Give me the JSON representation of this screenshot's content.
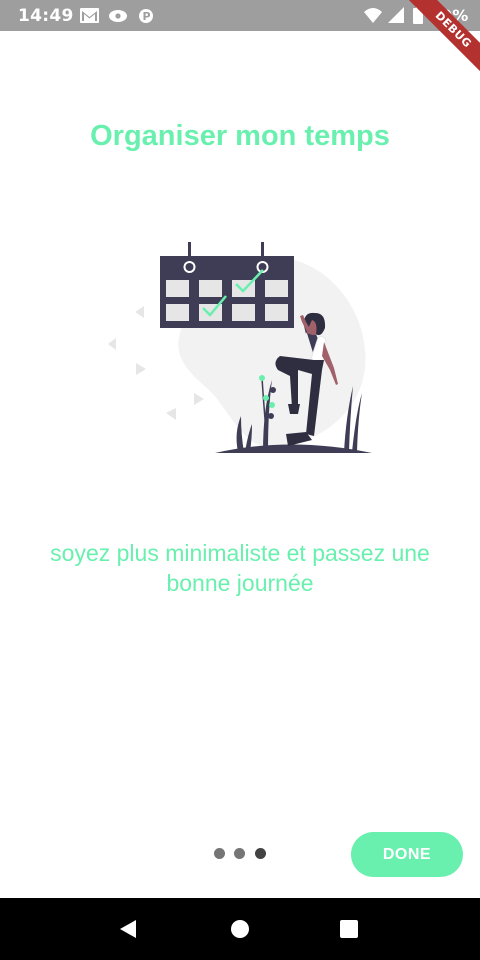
{
  "status_bar": {
    "time": "14:49",
    "battery": "99%",
    "left_icons": [
      "gmail-icon",
      "cast-icon",
      "p-icon"
    ],
    "right_icons": [
      "wifi-icon",
      "signal-icon",
      "battery-icon"
    ]
  },
  "debug_banner": "DEBUG",
  "onboarding": {
    "title": "Organiser mon temps",
    "description": "soyez plus minimaliste et passez une bonne journée",
    "page_count": 3,
    "current_page": 3,
    "done_label": "DONE"
  },
  "colors": {
    "accent": "#69f0ae",
    "calendar": "#3f3d56",
    "calendar_cell": "#e6e6e6",
    "blob": "#f2f2f2",
    "dot_inactive": "#757575",
    "dot_active": "#424242"
  },
  "nav_bar": {
    "icons": [
      "back-icon",
      "home-icon",
      "recents-icon"
    ]
  }
}
